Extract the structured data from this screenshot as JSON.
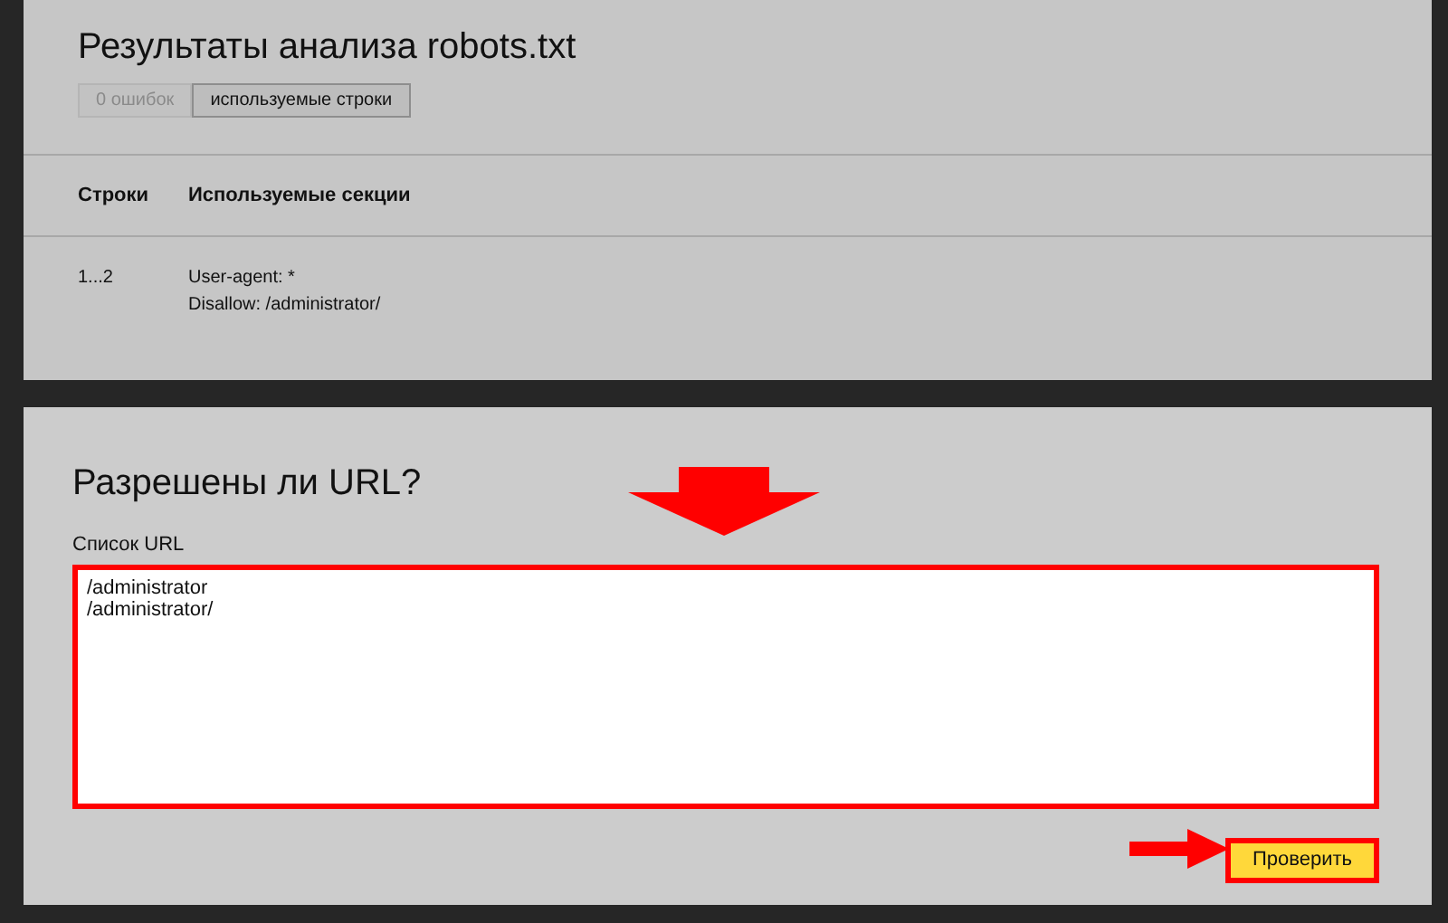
{
  "results": {
    "title": "Результаты анализа robots.txt",
    "tabs": [
      {
        "label": "0 ошибок",
        "selected": false
      },
      {
        "label": "используемые строки",
        "selected": true
      }
    ],
    "table": {
      "columns": [
        "Строки",
        "Используемые секции"
      ],
      "rows": [
        {
          "lines": "1...2",
          "sections": [
            "User-agent: *",
            "Disallow: /administrator/"
          ]
        }
      ]
    }
  },
  "url_check": {
    "title": "Разрешены ли URL?",
    "field_label": "Список URL",
    "urls": [
      "/administrator",
      "/administrator/"
    ],
    "highlighted": true,
    "button": "Проверить"
  }
}
